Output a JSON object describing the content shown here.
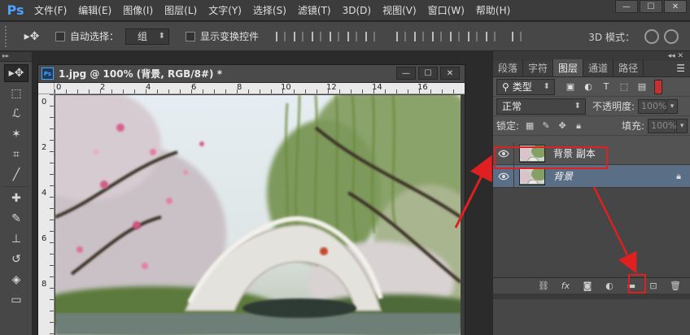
{
  "app": {
    "logo": "Ps"
  },
  "menu": [
    "文件(F)",
    "编辑(E)",
    "图像(I)",
    "图层(L)",
    "文字(Y)",
    "选择(S)",
    "滤镜(T)",
    "3D(D)",
    "视图(V)",
    "窗口(W)",
    "帮助(H)"
  ],
  "window_buttons": {
    "minimize": "—",
    "restore": "☐",
    "close": "✕"
  },
  "options": {
    "auto_select_label": "自动选择：",
    "auto_select_value": "组",
    "show_transform_label": "显示变换控件",
    "mode_3d_label": "3D 模式："
  },
  "document": {
    "title": "1.jpg @ 100% (背景, RGB/8#) *",
    "ruler_top": [
      "0",
      "2",
      "4",
      "6",
      "8",
      "10",
      "12",
      "14",
      "16"
    ],
    "ruler_left": [
      "0",
      "2",
      "4",
      "6",
      "8"
    ]
  },
  "layers_panel": {
    "tabs": [
      "段落",
      "字符",
      "图层",
      "通道",
      "路径"
    ],
    "active_tab": "图层",
    "filter_label": "类型",
    "blend_mode": "正常",
    "opacity_label": "不透明度:",
    "opacity_value": "100%",
    "lock_label": "锁定:",
    "fill_label": "填充:",
    "fill_value": "100%",
    "layers": [
      {
        "name": "背景 副本",
        "visible": true,
        "selected": false,
        "locked": false
      },
      {
        "name": "背景",
        "visible": true,
        "selected": true,
        "locked": true
      }
    ]
  },
  "colors": {
    "annotation": "#e02020",
    "selected_layer": "#5a6e86",
    "ps_blue": "#4ba3ff"
  }
}
